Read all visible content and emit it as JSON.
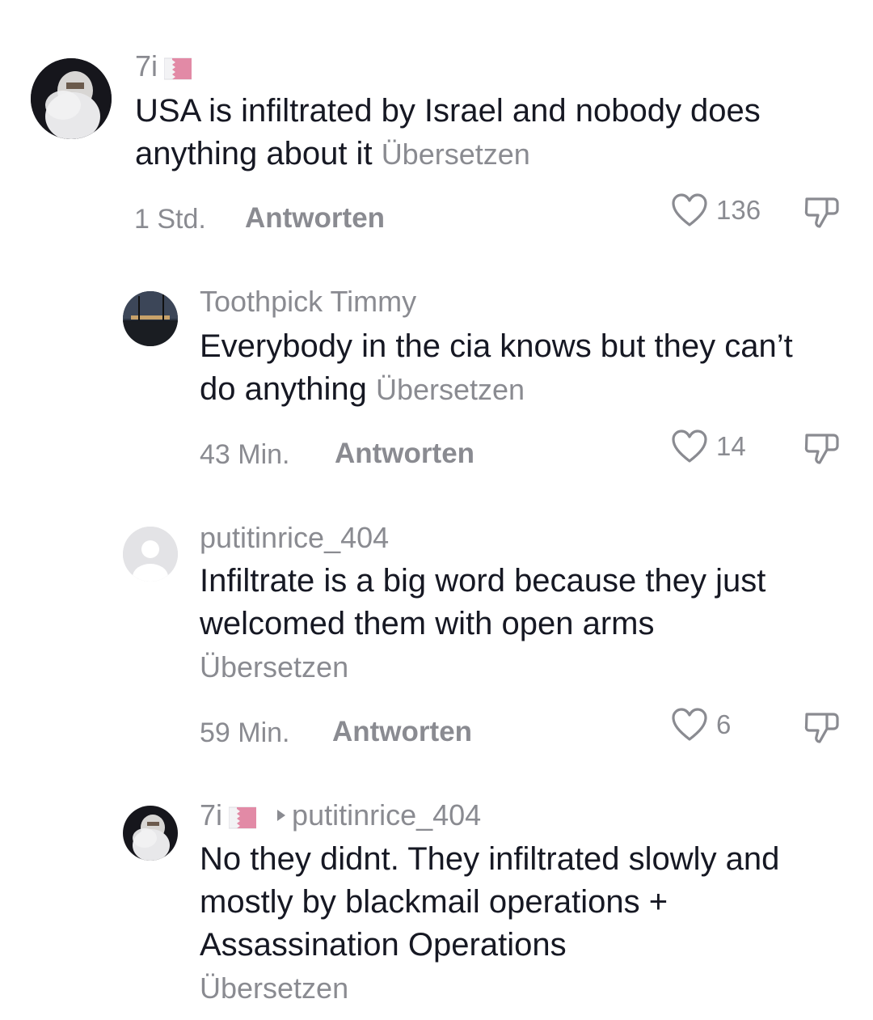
{
  "translate_label": "Übersetzen",
  "reply_label": "Antworten",
  "comments": [
    {
      "username": "7i",
      "flag": "bahrain-flag",
      "text": "USA is infiltrated by Israel and nobody does anything about it",
      "time": "1 Std.",
      "likes": "136"
    },
    {
      "username": "Toothpick Timmy",
      "text": "Everybody in the cia knows but they can’t do anything",
      "time": "43 Min.",
      "likes": "14"
    },
    {
      "username": "putitinrice_404",
      "text": "Infiltrate is a big word because they just welcomed them with open arms",
      "time": "59 Min.",
      "likes": "6"
    },
    {
      "username": "7i",
      "flag": "bahrain-flag",
      "reply_to": "putitinrice_404",
      "text": "No they didnt. They infiltrated slowly and mostly by blackmail operations + Assassination Operations"
    }
  ],
  "colors": {
    "text": "#161823",
    "muted": "#8a8b91",
    "flag_red": "#e28aa6"
  }
}
